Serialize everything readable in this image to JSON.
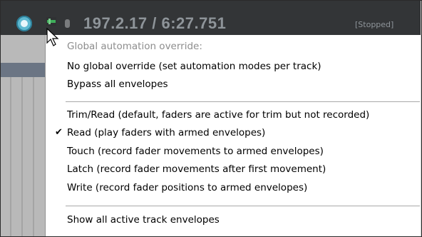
{
  "transport": {
    "time": "197.2.17 / 6:27.751",
    "status": "[Stopped]"
  },
  "menu": {
    "header": "Global automation override:",
    "items": [
      {
        "label": "No global override (set automation modes per track)",
        "checked": false
      },
      {
        "label": "Bypass all envelopes",
        "checked": false
      },
      {
        "label": "Trim/Read (default, faders are active for trim but not recorded)",
        "checked": false
      },
      {
        "label": "Read (play faders with armed envelopes)",
        "checked": true
      },
      {
        "label": "Touch (record fader movements to armed envelopes)",
        "checked": false
      },
      {
        "label": "Latch (record fader movements after first movement)",
        "checked": false
      },
      {
        "label": "Write (record fader positions to armed envelopes)",
        "checked": false
      },
      {
        "label": "Show all active track envelopes",
        "checked": false
      }
    ],
    "check_glyph": "✔"
  },
  "colors": {
    "transport_bg": "#333537",
    "time_text": "#8e9499",
    "accent_cyan": "#5fb9d1",
    "indicator_green": "#3fae5a"
  },
  "icons": [
    "play-state-icon",
    "automation-mode-icon",
    "mouse-cursor-icon",
    "checkmark-icon"
  ]
}
